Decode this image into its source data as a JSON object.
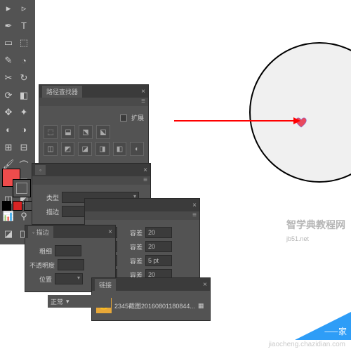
{
  "colors": {
    "fill": "#ee4c4c",
    "mini_black": "#000000",
    "mini_red": "#d82424"
  },
  "tools": [
    "▸",
    "▹",
    "✒",
    "T",
    "▭",
    "⬚",
    "✎",
    "◔",
    "✂",
    "↻",
    "⟳",
    "◧",
    "✥",
    "✦",
    "◐",
    "◑",
    "⊞",
    "⊟",
    "🖌",
    "⌒",
    "⬔",
    "⬕",
    "◫",
    "◩",
    "📊",
    "⚲",
    "◪",
    "◨"
  ],
  "panels": {
    "pathfinder": {
      "title": "路径查找器",
      "extend_label": "扩展",
      "icons": [
        "⬚",
        "⬓",
        "⬔",
        "⬕",
        "◫",
        "◩",
        "◪",
        "◨",
        "◧",
        "◐"
      ]
    },
    "stroke": {
      "title": "描边",
      "type_label": "类型",
      "thickness_label": "粗细",
      "opacity_label": "不透明度",
      "position_label": "位置"
    },
    "tracing": {
      "tolerance_label": "容差",
      "tolerance_values": [
        "20",
        "20",
        "5 pt",
        "20"
      ]
    },
    "links": {
      "title": "链接",
      "item": "2345截图20160801180844..."
    }
  },
  "status": {
    "label": "正常"
  },
  "watermark": {
    "main": "智学典教程网",
    "sub": "jiaocheng.chazidian.com",
    "site": "jb51.net",
    "corner": "⸺家"
  }
}
